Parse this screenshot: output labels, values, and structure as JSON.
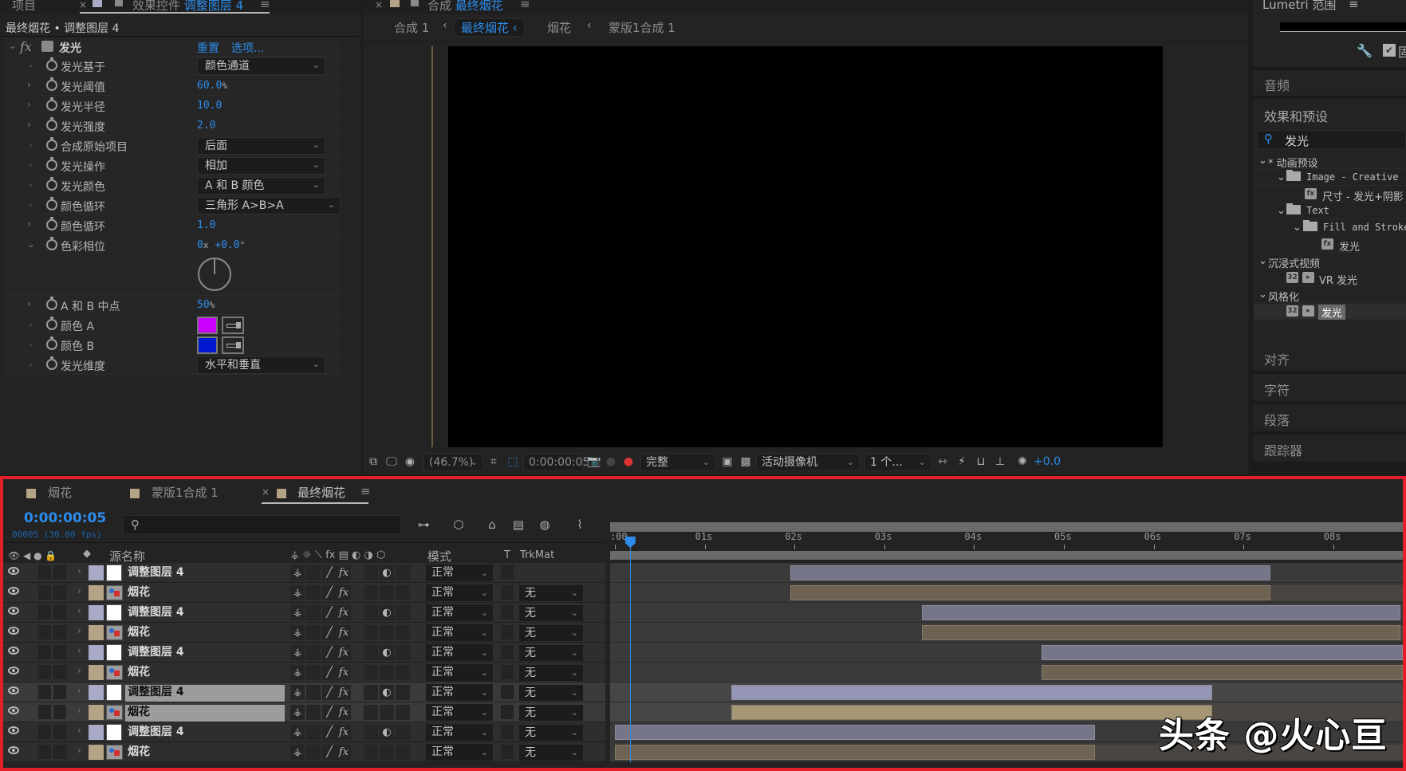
{
  "left_panel": {
    "tabs": [
      {
        "label": "项目"
      },
      {
        "label": "效果控件"
      }
    ],
    "active_tab_target": "调整图层 4",
    "breadcrumb": "最终烟花 • 调整图层 4",
    "effect": {
      "name": "发光",
      "reset": "重置",
      "options": "选项..."
    },
    "properties": [
      {
        "label": "发光基于",
        "type": "dropdown",
        "value": "颜色通道",
        "expandable": false
      },
      {
        "label": "发光阈值",
        "type": "number",
        "value": "60.0",
        "unit": "%",
        "expandable": true
      },
      {
        "label": "发光半径",
        "type": "number",
        "value": "10.0",
        "unit": "",
        "expandable": true
      },
      {
        "label": "发光强度",
        "type": "number",
        "value": "2.0",
        "unit": "",
        "expandable": true
      },
      {
        "label": "合成原始项目",
        "type": "dropdown",
        "value": "后面",
        "expandable": false
      },
      {
        "label": "发光操作",
        "type": "dropdown",
        "value": "相加",
        "expandable": false
      },
      {
        "label": "发光颜色",
        "type": "dropdown",
        "value": "A 和 B 颜色",
        "expandable": false
      },
      {
        "label": "颜色循环",
        "type": "dropdown",
        "value": "三角形 A>B>A",
        "expandable": false
      },
      {
        "label": "颜色循环",
        "type": "number",
        "value": "1.0",
        "unit": "",
        "expandable": true
      },
      {
        "label": "色彩相位",
        "type": "angle",
        "value": "0x +0.0°",
        "revolutions": "0",
        "revolutions_unit": "x",
        "degrees": "+0.0",
        "degrees_unit": "°",
        "expandable": true,
        "expanded": true
      },
      {
        "label": "A 和 B 中点",
        "type": "number",
        "value": "50",
        "unit": "%",
        "expandable": true
      },
      {
        "label": "颜色 A",
        "type": "color",
        "value": "#cc00ff",
        "expandable": false
      },
      {
        "label": "颜色 B",
        "type": "color",
        "value": "#0018d0",
        "expandable": false
      },
      {
        "label": "发光维度",
        "type": "dropdown",
        "value": "水平和垂直",
        "expandable": false
      }
    ]
  },
  "viewer": {
    "panel_title_prefix": "合成",
    "panel_title": "最终烟花",
    "breadcrumbs": [
      {
        "label": "合成 1"
      },
      {
        "label": "最终烟花",
        "active": true
      },
      {
        "label": "烟花"
      },
      {
        "label": "蒙版1合成 1"
      }
    ],
    "toolbar": {
      "zoom": "(46.7%)",
      "timecode": "0:00:00:05",
      "resolution": "完整",
      "camera": "活动摄像机",
      "views": "1 个...",
      "exposure": "+0.0"
    }
  },
  "right_panel": {
    "lumetri_title": "Lumetri 范围",
    "lumetri_checkbox_label": "固",
    "sections": [
      "音频",
      "效果和预设"
    ],
    "search_value": "发光",
    "tree": [
      {
        "label": "* 动画预设",
        "level": 0,
        "kind": "group"
      },
      {
        "label": "Image - Creative",
        "level": 1,
        "kind": "folder"
      },
      {
        "label": "尺寸 - 发光+阴影",
        "level": 2,
        "kind": "preset"
      },
      {
        "label": "Text",
        "level": 1,
        "kind": "folder"
      },
      {
        "label": "Fill and Stroke",
        "level": 2,
        "kind": "folder"
      },
      {
        "label": "发光",
        "level": 3,
        "kind": "preset"
      },
      {
        "label": "沉浸式视频",
        "level": 0,
        "kind": "group"
      },
      {
        "label": "VR 发光",
        "level": 1,
        "kind": "effect",
        "badge": "32"
      },
      {
        "label": "风格化",
        "level": 0,
        "kind": "group"
      },
      {
        "label": "发光",
        "level": 1,
        "kind": "effect",
        "badge": "32",
        "selected": true
      }
    ],
    "collapsed_panels": [
      "对齐",
      "字符",
      "段落",
      "跟踪器"
    ]
  },
  "timeline": {
    "tabs": [
      {
        "label": "烟花"
      },
      {
        "label": "蒙版1合成 1"
      },
      {
        "label": "最终烟花",
        "active": true
      }
    ],
    "timecode": "0:00:00:05",
    "frame_info": "00005 (30.00 fps)",
    "search_placeholder": "",
    "columns": {
      "source_name": "源名称",
      "mode": "模式",
      "t": "T",
      "trkmat": "TrkMat"
    },
    "ruler": [
      ":00",
      "01s",
      "02s",
      "03s",
      "04s",
      "05s",
      "06s",
      "07s",
      "08s"
    ],
    "playhead_seconds": 0.167,
    "layers": [
      {
        "name": "调整图层 4",
        "type": "adjustment",
        "mode": "正常",
        "trkmat": "",
        "in": 1.95,
        "out": 7.3,
        "selected": false
      },
      {
        "name": "烟花",
        "type": "comp",
        "mode": "正常",
        "trkmat": "无",
        "in": 1.95,
        "out": 7.3,
        "selected": false
      },
      {
        "name": "调整图层 4",
        "type": "adjustment",
        "mode": "正常",
        "trkmat": "无",
        "in": 3.42,
        "out": 8.75,
        "selected": false
      },
      {
        "name": "烟花",
        "type": "comp",
        "mode": "正常",
        "trkmat": "无",
        "in": 3.42,
        "out": 8.75,
        "selected": false
      },
      {
        "name": "调整图层 4",
        "type": "adjustment",
        "mode": "正常",
        "trkmat": "无",
        "in": 4.75,
        "out": 9.0,
        "selected": false
      },
      {
        "name": "烟花",
        "type": "comp",
        "mode": "正常",
        "trkmat": "无",
        "in": 4.75,
        "out": 9.0,
        "selected": false
      },
      {
        "name": "调整图层 4",
        "type": "adjustment",
        "mode": "正常",
        "trkmat": "无",
        "in": 1.3,
        "out": 6.65,
        "selected": true
      },
      {
        "name": "烟花",
        "type": "comp",
        "mode": "正常",
        "trkmat": "无",
        "in": 1.3,
        "out": 6.65,
        "selected": true
      },
      {
        "name": "调整图层 4",
        "type": "adjustment",
        "mode": "正常",
        "trkmat": "无",
        "in": 0.0,
        "out": 5.35,
        "selected": false
      },
      {
        "name": "烟花",
        "type": "comp",
        "mode": "正常",
        "trkmat": "无",
        "in": 0.0,
        "out": 5.35,
        "selected": false
      }
    ]
  },
  "watermark": "头条 @火心亘",
  "colors": {
    "accent": "#2d8ceb",
    "adjustment_label": "#a9aac8",
    "comp_label": "#b4a385",
    "highlight_border": "#e3202a"
  }
}
